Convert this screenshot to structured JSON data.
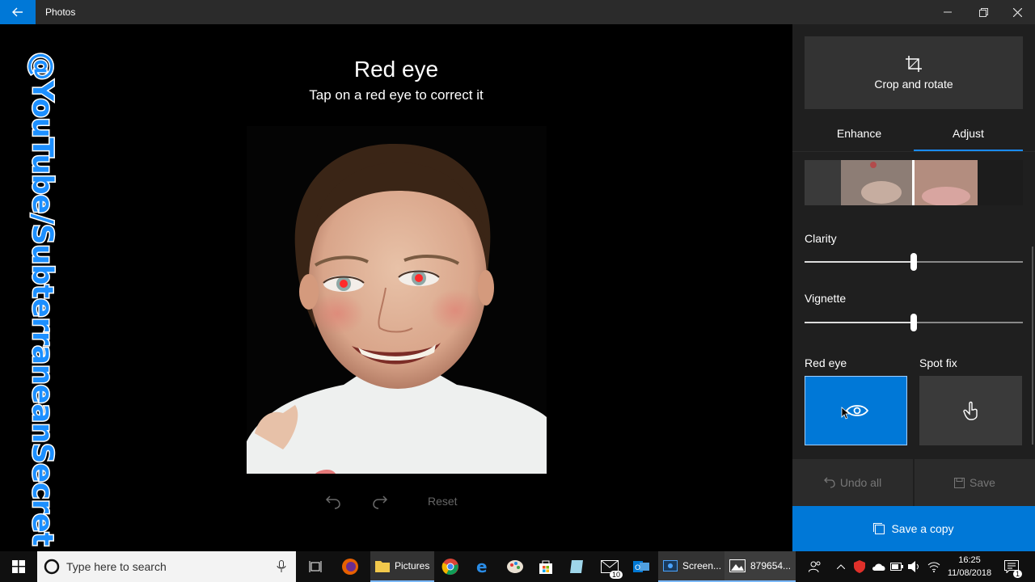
{
  "window": {
    "title": "Photos"
  },
  "editor": {
    "header_title": "Red eye",
    "header_subtitle": "Tap on a red eye to correct it",
    "reset_label": "Reset"
  },
  "panel": {
    "crop_label": "Crop and rotate",
    "tabs": [
      {
        "label": "Enhance"
      },
      {
        "label": "Adjust",
        "active": true
      }
    ],
    "clarity_label": "Clarity",
    "clarity_value": 0.5,
    "vignette_label": "Vignette",
    "vignette_value": 0.5,
    "redeye_label": "Red eye",
    "spotfix_label": "Spot fix",
    "undo_all_label": "Undo all",
    "save_label": "Save",
    "save_copy_label": "Save a copy"
  },
  "watermark": {
    "text": "@YouTube/SubterraneanSecret"
  },
  "taskbar": {
    "search_placeholder": "Type here to search",
    "tasks": [
      {
        "label": "Pictures"
      },
      {
        "label": "Screen..."
      },
      {
        "label": "879654..."
      }
    ],
    "mail_badge": "10",
    "notification_count": "1",
    "time": "16:25",
    "date": "11/08/2018"
  },
  "colors": {
    "accent": "#0078d7",
    "watermark": "#1c8fff"
  }
}
